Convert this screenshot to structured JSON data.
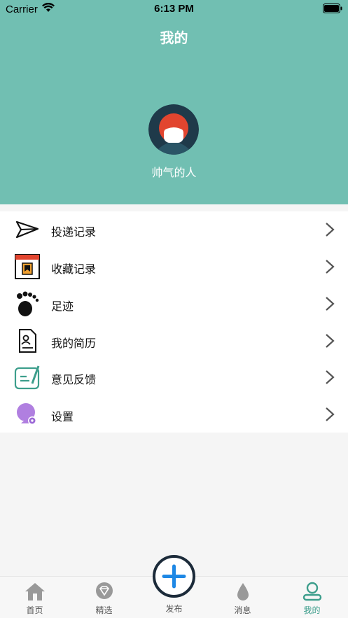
{
  "status_bar": {
    "carrier": "Carrier",
    "time": "6:13 PM"
  },
  "header": {
    "title": "我的",
    "username": "帅气的人"
  },
  "menu": {
    "items": [
      {
        "label": "投递记录",
        "icon": "paper-plane-icon"
      },
      {
        "label": "收藏记录",
        "icon": "bookmark-calendar-icon"
      },
      {
        "label": "足迹",
        "icon": "footprint-icon"
      },
      {
        "label": "我的简历",
        "icon": "resume-document-icon"
      },
      {
        "label": "意见反馈",
        "icon": "feedback-pen-icon"
      },
      {
        "label": "设置",
        "icon": "settings-user-icon"
      }
    ]
  },
  "tabbar": {
    "tabs": [
      {
        "label": "首页",
        "icon": "home-icon"
      },
      {
        "label": "精选",
        "icon": "diamond-icon"
      },
      {
        "label": "发布",
        "icon": "plus-circle-icon"
      },
      {
        "label": "消息",
        "icon": "drop-icon"
      },
      {
        "label": "我的",
        "icon": "user-icon",
        "active": true
      }
    ]
  },
  "colors": {
    "header_bg": "#71bfb2",
    "accent": "#3d9e8c",
    "publish_plus": "#1e88e5"
  }
}
